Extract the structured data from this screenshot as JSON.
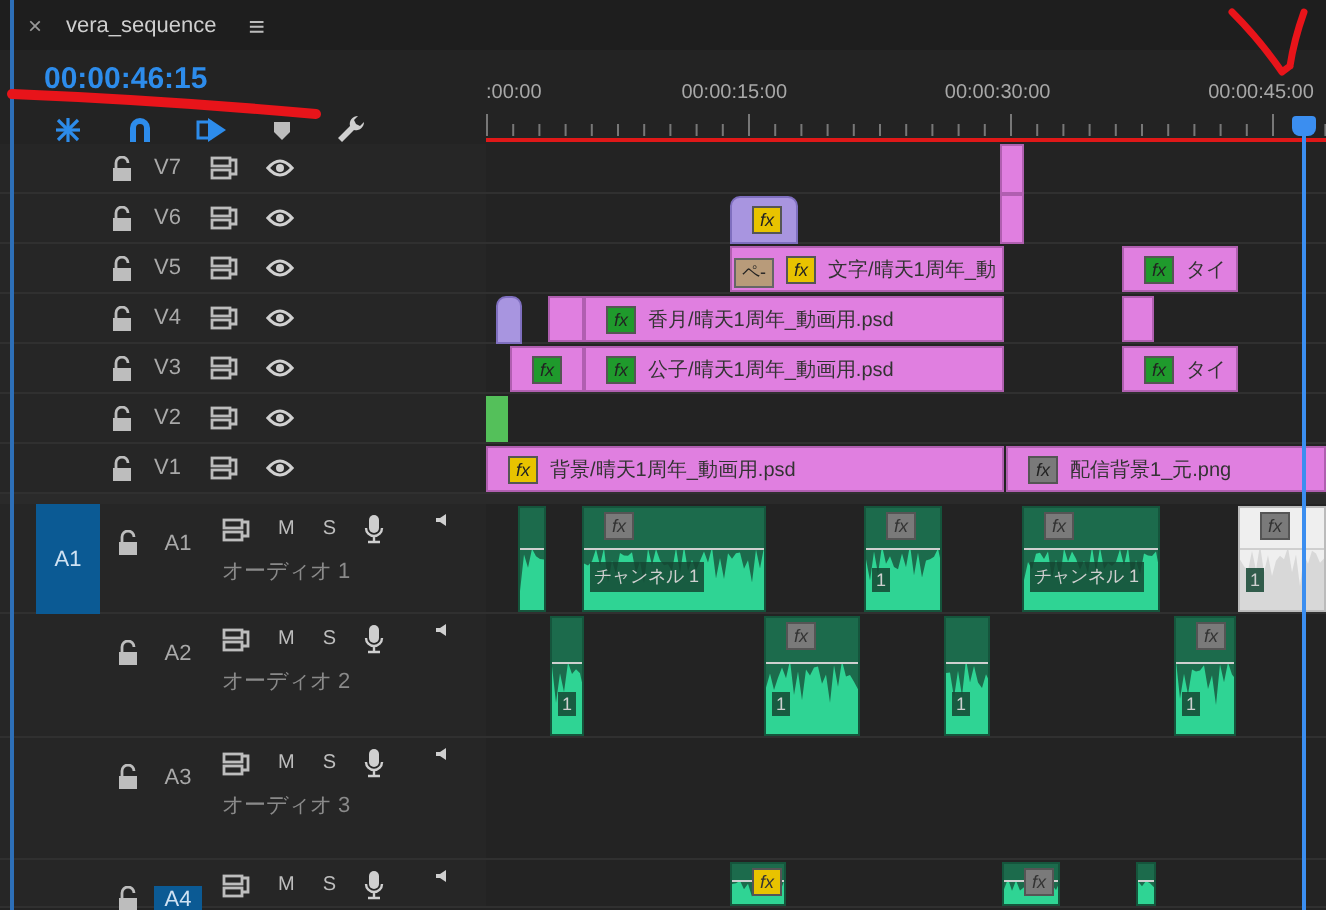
{
  "tab": {
    "close": "×",
    "title": "vera_sequence",
    "menu": "≡"
  },
  "timecode": "00:00:46:15",
  "ruler": [
    ":00:00",
    "00:00:15:00",
    "00:00:30:00",
    "00:00:45:00"
  ],
  "video_tracks": [
    {
      "name": "V7",
      "clips": [
        {
          "kind": "video"
        }
      ]
    },
    {
      "name": "V6",
      "clips": [
        {
          "kind": "transition",
          "fx": {
            "text": "fx",
            "color": "#e8c300"
          }
        },
        {
          "kind": "video"
        }
      ]
    },
    {
      "name": "V5",
      "clips": [
        {
          "kind": "video",
          "tag": "ペ-",
          "fx": {
            "text": "fx",
            "color": "#e8c300"
          },
          "label": "文字/晴天1周年_動"
        },
        {
          "kind": "video",
          "fx": {
            "text": "fx",
            "color": "#1f9a2c"
          },
          "label": "タイ"
        }
      ]
    },
    {
      "name": "V4",
      "clips": [
        {
          "kind": "transition"
        },
        {
          "kind": "video"
        },
        {
          "kind": "video",
          "fx": {
            "text": "fx",
            "color": "#1f9a2c"
          },
          "label": "香月/晴天1周年_動画用.psd"
        },
        {
          "kind": "video"
        }
      ]
    },
    {
      "name": "V3",
      "clips": [
        {
          "kind": "video",
          "fx": {
            "text": "fx",
            "color": "#1f9a2c"
          }
        },
        {
          "kind": "video",
          "fx": {
            "text": "fx",
            "color": "#1f9a2c"
          },
          "label": "公子/晴天1周年_動画用.psd"
        },
        {
          "kind": "video",
          "fx": {
            "text": "fx",
            "color": "#1f9a2c"
          },
          "label": "タイ"
        }
      ]
    },
    {
      "name": "V2",
      "clips": [
        {
          "kind": "solid"
        }
      ]
    },
    {
      "name": "V1",
      "clips": [
        {
          "kind": "video",
          "fx": {
            "text": "fx",
            "color": "#e8c300"
          },
          "label": "背景/晴天1周年_動画用.psd"
        },
        {
          "kind": "video",
          "fx": {
            "text": "fx",
            "color": "#7a7a7a"
          },
          "label": "配信背景1_元.png"
        }
      ]
    }
  ],
  "audio_tracks": [
    {
      "source_patch": "A1",
      "name": "A1",
      "targeted": false,
      "mute": "M",
      "solo": "S",
      "label": "オーディオ 1",
      "clips": [
        {
          "selected": false
        },
        {
          "selected": false,
          "fx": {
            "text": "fx",
            "color": "#7a7a7a"
          },
          "label": "チャンネル 1"
        },
        {
          "selected": false,
          "fx": {
            "text": "fx",
            "color": "#7a7a7a"
          },
          "label": "1"
        },
        {
          "selected": false,
          "fx": {
            "text": "fx",
            "color": "#7a7a7a"
          },
          "label": "チャンネル 1"
        },
        {
          "selected": true,
          "fx": {
            "text": "fx",
            "color": "#7a7a7a"
          },
          "label": "1"
        }
      ]
    },
    {
      "name": "A2",
      "targeted": false,
      "mute": "M",
      "solo": "S",
      "label": "オーディオ 2",
      "clips": [
        {
          "selected": false,
          "label": "1"
        },
        {
          "selected": false,
          "fx": {
            "text": "fx",
            "color": "#7a7a7a"
          },
          "label": "1"
        },
        {
          "selected": false,
          "label": "1"
        },
        {
          "selected": false,
          "fx": {
            "text": "fx",
            "color": "#7a7a7a"
          },
          "label": "1"
        }
      ]
    },
    {
      "name": "A3",
      "targeted": false,
      "mute": "M",
      "solo": "S",
      "label": "オーディオ 3"
    },
    {
      "name": "A4",
      "targeted": true,
      "mute": "M",
      "solo": "S",
      "clips": [
        {
          "selected": false,
          "fx": {
            "text": "fx",
            "color": "#e8c300"
          }
        },
        {
          "selected": false,
          "fx": {
            "text": "fx",
            "color": "#7a7a7a"
          }
        },
        {
          "selected": false
        }
      ]
    }
  ]
}
